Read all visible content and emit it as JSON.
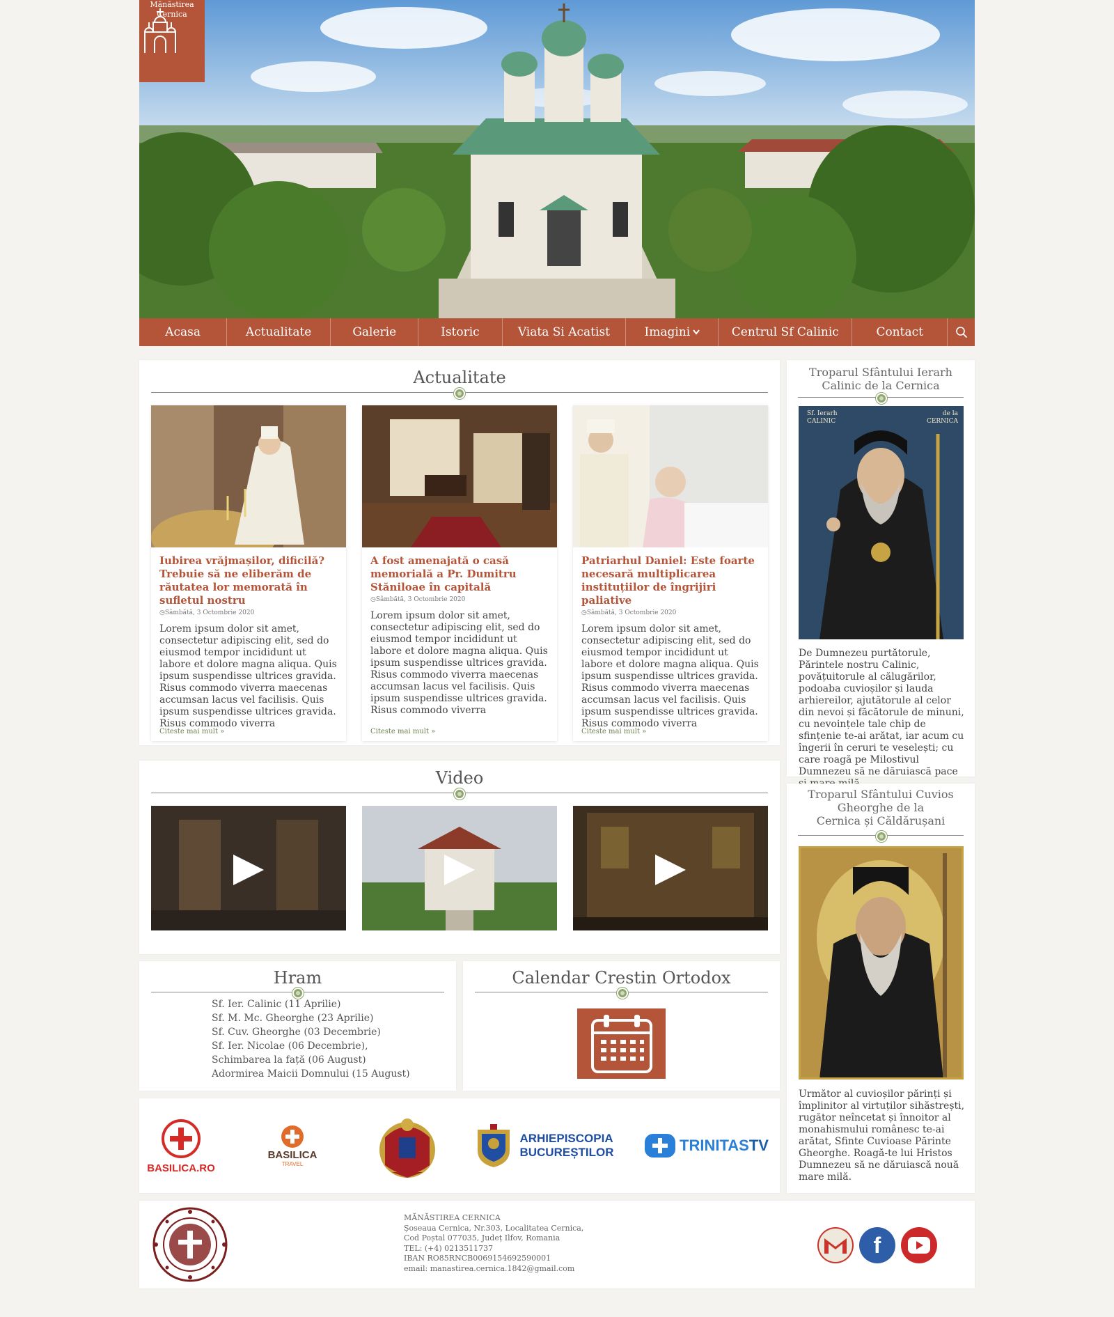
{
  "site": {
    "logo_line1": "Mănăstirea",
    "logo_line2": "Cernica"
  },
  "nav": [
    {
      "label": "Acasa"
    },
    {
      "label": "Actualitate"
    },
    {
      "label": "Galerie"
    },
    {
      "label": "Istoric"
    },
    {
      "label": "Viata Si Acatist"
    },
    {
      "label": "Imagini"
    },
    {
      "label": "Centrul Sf Calinic"
    },
    {
      "label": "Contact"
    }
  ],
  "news": {
    "title": "Actualitate",
    "read_more": "Citeste mai mult",
    "items": [
      {
        "title": "Iubirea vrăjmașilor, dificilă? Trebuie să ne eliberăm de răutatea lor memorată în sufletul nostru",
        "date": "Sâmbătă, 3 Octombrie 2020",
        "body": "Lorem ipsum dolor sit amet, consectetur adipiscing elit, sed do eiusmod tempor incididunt ut labore et dolore magna aliqua. Quis ipsum suspendisse ultrices gravida. Risus commodo viverra maecenas accumsan lacus vel facilisis. Quis ipsum suspendisse ultrices gravida. Risus commodo viverra"
      },
      {
        "title": "A fost amenajată o casă memorială a Pr. Dumitru Stăniloae în capitală",
        "date": "Sâmbătă, 3 Octombrie 2020",
        "body": "Lorem ipsum dolor sit amet, consectetur adipiscing elit, sed do eiusmod tempor incididunt ut labore et dolore magna aliqua. Quis ipsum suspendisse ultrices gravida. Risus commodo viverra maecenas accumsan lacus vel facilisis. Quis ipsum suspendisse ultrices gravida. Risus commodo viverra"
      },
      {
        "title": "Patriarhul Daniel: Este foarte necesară multiplicarea instituțiilor de îngrijiri paliative",
        "date": "Sâmbătă, 3 Octombrie 2020",
        "body": "Lorem ipsum dolor sit amet, consectetur adipiscing elit, sed do eiusmod tempor incididunt ut labore et dolore magna aliqua. Quis ipsum suspendisse ultrices gravida. Risus commodo viverra maecenas accumsan lacus vel facilisis. Quis ipsum suspendisse ultrices gravida. Risus commodo viverra"
      }
    ]
  },
  "video": {
    "title": "Video"
  },
  "hram": {
    "title": "Hram",
    "items": [
      "Sf. Ier. Calinic (11 Aprilie)",
      "Sf. M. Mc. Gheorghe (23 Aprilie)",
      "Sf. Cuv. Gheorghe (03 Decembrie)",
      "Sf. Ier. Nicolae (06 Decembrie),",
      "Schimbarea la față (06 August)",
      "Adormirea Maicii Domnului (15 August)"
    ]
  },
  "calendar": {
    "title": "Calendar Crestin Ortodox"
  },
  "sidebar": {
    "troparion1": {
      "title_line1": "Troparul Sfântului Ierarh",
      "title_line2": "Calinic de la Cernica",
      "icon_label_left": "Sf. Ierarh CALINIC",
      "icon_label_right": "de la CERNICA",
      "text": "De Dumnezeu purtătorule, Părintele nostru Calinic, povățuitorule al călugărilor, podoaba cuvioșilor și lauda arhiereilor, ajutătorule al celor din nevoi și făcătorule de minuni, cu nevoințele tale chip de sfințenie te-ai arătat, iar acum cu îngerii în ceruri te veselești; cu care roagă pe Milostivul Dumnezeu să ne dăruiască pace și mare milă."
    },
    "troparion2": {
      "title_line1": "Troparul Sfântului Cuvios",
      "title_line2": "Gheorghe de la",
      "title_line3": "Cernica  și  Căldărușani",
      "text": "Următor al cuvioșilor părinți și împlinitor al virtuților sihăstrești, rugător neîncetat și înnoitor al monahismului românesc te-ai arătat, Sfinte Cuvioase Părinte Gheorghe. Roagă-te lui Hristos Dumnezeu să ne dăruiască nouă mare milă."
    }
  },
  "partners": {
    "basilica": "BASILICA.RO",
    "basilica_travel": "BASILICA",
    "basilica_travel_sub": "TRAVEL",
    "arhiepiscopia_line1": "ARHIEPISCOPIA",
    "arhiepiscopia_line2": "BUCUREȘTILOR",
    "trinitas": "TRINITAS",
    "trinitas_tv": "TV"
  },
  "footer": {
    "lines": [
      "MĂNĂSTIREA CERNICA",
      "Șoseaua Cernica, Nr.303, Localitatea Cernica,",
      "Cod Poștal 077035, Județ Ilfov, Romania",
      "TEL: (+4) 0213511737",
      "IBAN  RO85RNCB0069154692590001",
      "email:  manastirea.cernica.1842@gmail.com"
    ]
  },
  "colors": {
    "accent": "#b4553a",
    "panel": "#ffffff",
    "background": "#f4f3f0",
    "divider_dot": "#8fa66f",
    "read_more": "#6a7f4f"
  },
  "icons": [
    "church-logo-icon",
    "search-icon",
    "chevron-down-icon",
    "calendar-icon",
    "play-icon",
    "clock-icon",
    "gmail-icon",
    "facebook-icon",
    "youtube-icon"
  ]
}
